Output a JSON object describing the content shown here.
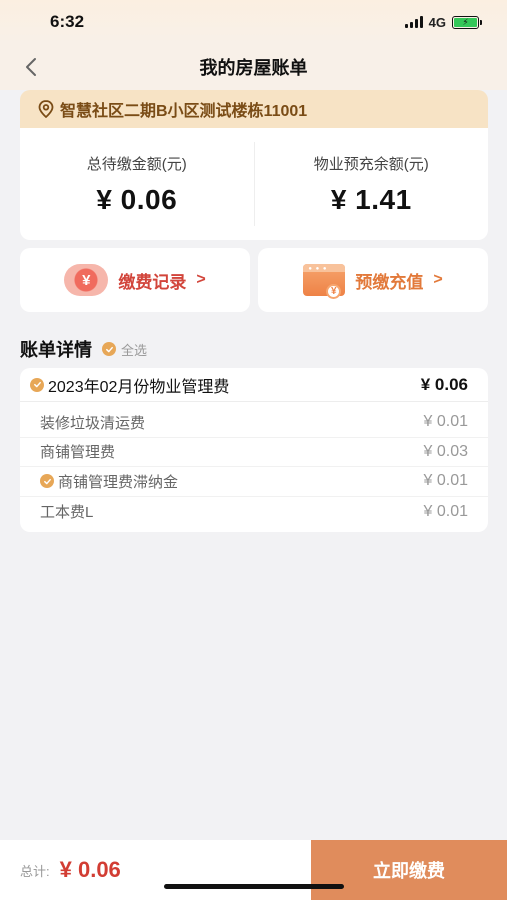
{
  "status_bar": {
    "time": "6:32",
    "network": "4G",
    "battery_icon": "battery-charging-icon"
  },
  "nav": {
    "title": "我的房屋账单",
    "back_icon": "chevron-left-icon"
  },
  "address": {
    "icon": "location-pin-icon",
    "text": "智慧社区二期B小区测试楼栋11001"
  },
  "balance": {
    "due_label": "总待缴金额(元)",
    "due_value": "¥ 0.06",
    "prepaid_label": "物业预充余额(元)",
    "prepaid_value": "¥ 1.41"
  },
  "actions": {
    "records_label": "缴费记录",
    "records_arrow": ">",
    "records_icon": "yen-circle-icon",
    "recharge_label": "预缴充值",
    "recharge_arrow": ">",
    "recharge_icon": "wallet-yen-icon"
  },
  "bill_section": {
    "title": "账单详情",
    "select_all_label": "全选",
    "header": {
      "name": "2023年02月份物业管理费",
      "amount": "¥ 0.06"
    },
    "lines": [
      {
        "name": "装修垃圾清运费",
        "amount": "¥ 0.01",
        "checked": false
      },
      {
        "name": "商铺管理费",
        "amount": "¥ 0.03",
        "checked": false
      },
      {
        "name": "商铺管理费滞纳金",
        "amount": "¥ 0.01",
        "checked": true
      },
      {
        "name": "工本费L",
        "amount": "¥ 0.01",
        "checked": false
      }
    ]
  },
  "footer": {
    "total_label": "总计:",
    "total_value": "¥ 0.06",
    "pay_button_label": "立即缴费"
  },
  "colors": {
    "accent_orange": "#e08c5c",
    "price_red": "#d23d33",
    "address_bg": "#f7e3c5",
    "check_gold": "#e7a757"
  }
}
